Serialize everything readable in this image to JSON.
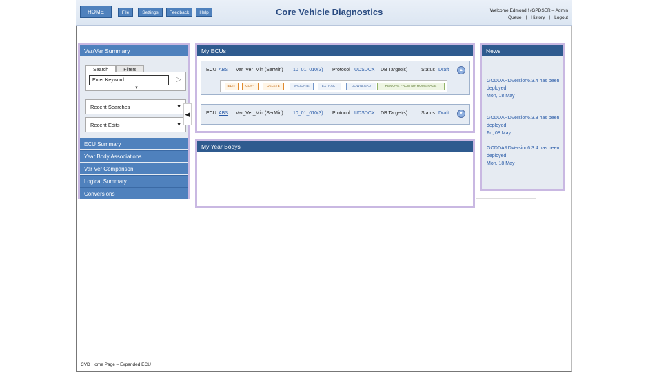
{
  "header": {
    "title": "Core Vehicle Diagnostics",
    "welcome": "Welcome Edmond !  (GPDSER – Admin",
    "nav": [
      "HOME",
      "File",
      "Settings",
      "Feedback",
      "Help"
    ],
    "links": [
      "Queue",
      "History",
      "Logout"
    ]
  },
  "left": {
    "title": "Var/Ver Summary",
    "tabs": [
      "Search",
      "Filters"
    ],
    "search_placeholder": "Enter Keyword",
    "recent_searches": "Recent Searches",
    "recent_edits": "Recent Edits",
    "links": [
      "ECU Summary",
      "Year Body Associations",
      "Var Ver Comparison",
      "Logical Summary",
      "Conversions"
    ]
  },
  "ecus": {
    "title": "My ECUs",
    "rows": [
      {
        "ecu_label": "ECU",
        "ecu": "ABS",
        "var_label": "Var_Ver_Min (SerMin)",
        "var": "10_01_010(3)",
        "proto_label": "Protocol",
        "proto": "UDSDCX",
        "db": "DB Target(s)",
        "status_label": "Status",
        "status": "Draft"
      },
      {
        "ecu_label": "ECU",
        "ecu": "ABS",
        "var_label": "Var_Ver_Min (SerMin)",
        "var": "10_01_010(3)",
        "proto_label": "Protocol",
        "proto": "UDSDCX",
        "db": "DB Target(s)",
        "status_label": "Status",
        "status": "Draft"
      }
    ],
    "actions": [
      "EDIT",
      "COPY",
      "DELETE",
      "VALIDATE",
      "EXTRACT",
      "DOWNLOAD",
      "REMOVE FROM MY HOME PAGE"
    ]
  },
  "years": {
    "title": "My Year Bodys"
  },
  "news": {
    "title": "News",
    "items": [
      {
        "text": "GODDARDVersion6.3.4 has been deployed.",
        "date": "Mon, 18 May"
      },
      {
        "text": "GODDARDVersion6.3.3 has been deployed.",
        "date": "Fri, 08 May"
      },
      {
        "text": "GODDARDVersion6.3.4 has been deployed.",
        "date": "Mon, 18 May"
      }
    ]
  },
  "footer": "CVD Home Page – Expanded ECU",
  "colors": {
    "header_blue": "#2f5b8f",
    "nav_blue": "#4f81bd",
    "panel_border": "#c9b8e2"
  }
}
